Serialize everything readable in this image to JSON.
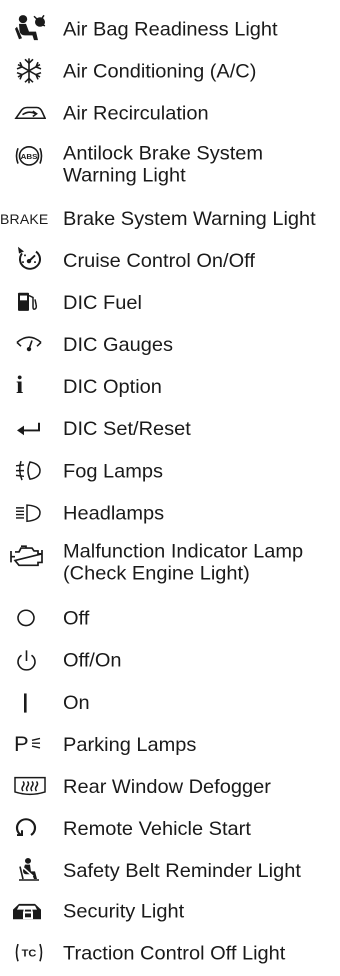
{
  "items": [
    {
      "icon": "air-bag-icon",
      "lines": [
        "Air Bag Readiness Light"
      ]
    },
    {
      "icon": "air-conditioning-icon",
      "lines": [
        "Air Conditioning (A/C)"
      ]
    },
    {
      "icon": "air-recirculation-icon",
      "lines": [
        "Air Recirculation"
      ]
    },
    {
      "icon": "abs-icon",
      "icon_text": "ABS",
      "lines": [
        "Antilock Brake System",
        "Warning Light"
      ]
    },
    {
      "icon": "brake-text-icon",
      "icon_text": "BRAKE",
      "lines": [
        "Brake System Warning Light"
      ]
    },
    {
      "icon": "cruise-control-icon",
      "lines": [
        "Cruise Control On/Off"
      ]
    },
    {
      "icon": "fuel-icon",
      "lines": [
        "DIC Fuel"
      ]
    },
    {
      "icon": "gauges-icon",
      "lines": [
        "DIC Gauges"
      ]
    },
    {
      "icon": "info-icon",
      "icon_text": "i",
      "lines": [
        "DIC Option"
      ]
    },
    {
      "icon": "set-reset-arrow-icon",
      "lines": [
        "DIC Set/Reset"
      ]
    },
    {
      "icon": "fog-lamps-icon",
      "lines": [
        "Fog Lamps"
      ]
    },
    {
      "icon": "headlamps-icon",
      "lines": [
        "Headlamps"
      ]
    },
    {
      "icon": "check-engine-icon",
      "lines": [
        "Malfunction Indicator Lamp",
        "(Check Engine Light)"
      ]
    },
    {
      "icon": "off-circle-icon",
      "lines": [
        "Off"
      ]
    },
    {
      "icon": "power-icon",
      "lines": [
        "Off/On"
      ]
    },
    {
      "icon": "on-bar-icon",
      "lines": [
        "On"
      ]
    },
    {
      "icon": "parking-lamps-icon",
      "icon_text": "P",
      "lines": [
        "Parking Lamps"
      ]
    },
    {
      "icon": "rear-defogger-icon",
      "lines": [
        "Rear Window Defogger"
      ]
    },
    {
      "icon": "remote-start-icon",
      "lines": [
        "Remote Vehicle Start"
      ]
    },
    {
      "icon": "seat-belt-icon",
      "lines": [
        "Safety Belt Reminder Light"
      ]
    },
    {
      "icon": "security-icon",
      "lines": [
        "Security Light"
      ]
    },
    {
      "icon": "traction-control-icon",
      "icon_text": "TC",
      "lines": [
        "Traction Control Off Light"
      ]
    }
  ]
}
